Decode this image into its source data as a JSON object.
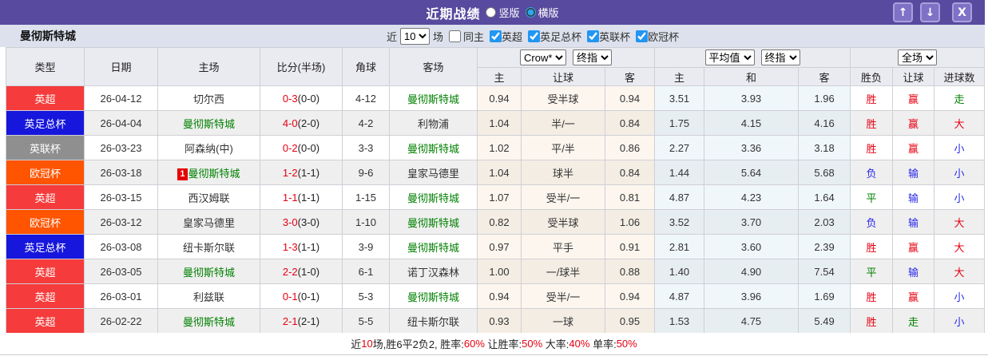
{
  "titlebar": {
    "title": "近期战绩",
    "radio_vertical": "竖版",
    "radio_horizontal": "横版",
    "buttons": {
      "up": "↑",
      "down": "↓",
      "close": "X"
    }
  },
  "controls": {
    "team": "曼彻斯特城",
    "near_label": "近",
    "count_value": "10",
    "games_label": "场",
    "same_home_label": "同主",
    "leagues": [
      "英超",
      "英足总杯",
      "英联杯",
      "欧冠杯"
    ]
  },
  "selectors": {
    "bookmaker": "Crow*",
    "handicap_time": "终指",
    "europe_source": "平均值",
    "europe_time": "终指",
    "scope": "全场"
  },
  "table": {
    "headers": {
      "type": "类型",
      "date": "日期",
      "home": "主场",
      "score": "比分(半场)",
      "corner": "角球",
      "away": "客场",
      "sub": [
        "主",
        "让球",
        "客",
        "主",
        "和",
        "客",
        "胜负",
        "让球",
        "进球数"
      ]
    },
    "rows": [
      {
        "league": "英超",
        "lc": "red",
        "date": "26-04-12",
        "home": "切尔西",
        "home_green": false,
        "marker": "",
        "score": "0-3",
        "half": "(0-0)",
        "corner": "4-12",
        "away": "曼彻斯特城",
        "away_green": true,
        "ah": [
          "0.94",
          "受半球",
          "0.94"
        ],
        "eu": [
          "3.51",
          "3.93",
          "1.96"
        ],
        "res": [
          "胜",
          "red"
        ],
        "ahres": [
          "赢",
          "red"
        ],
        "goal": [
          "走",
          "green"
        ]
      },
      {
        "league": "英足总杯",
        "lc": "blue",
        "date": "26-04-04",
        "home": "曼彻斯特城",
        "home_green": true,
        "marker": "",
        "score": "4-0",
        "half": "(2-0)",
        "corner": "4-2",
        "away": "利物浦",
        "away_green": false,
        "ah": [
          "1.04",
          "半/一",
          "0.84"
        ],
        "eu": [
          "1.75",
          "4.15",
          "4.16"
        ],
        "res": [
          "胜",
          "red"
        ],
        "ahres": [
          "赢",
          "red"
        ],
        "goal": [
          "大",
          "red"
        ]
      },
      {
        "league": "英联杯",
        "lc": "gray",
        "date": "26-03-23",
        "home": "阿森纳(中)",
        "home_green": false,
        "marker": "",
        "score": "0-2",
        "half": "(0-0)",
        "corner": "3-3",
        "away": "曼彻斯特城",
        "away_green": true,
        "ah": [
          "1.02",
          "平/半",
          "0.86"
        ],
        "eu": [
          "2.27",
          "3.36",
          "3.18"
        ],
        "res": [
          "胜",
          "red"
        ],
        "ahres": [
          "赢",
          "red"
        ],
        "goal": [
          "小",
          "blue"
        ]
      },
      {
        "league": "欧冠杯",
        "lc": "orange",
        "date": "26-03-18",
        "home": "曼彻斯特城",
        "home_green": true,
        "marker": "1",
        "score": "1-2",
        "half": "(1-1)",
        "corner": "9-6",
        "away": "皇家马德里",
        "away_green": false,
        "ah": [
          "1.04",
          "球半",
          "0.84"
        ],
        "eu": [
          "1.44",
          "5.64",
          "5.68"
        ],
        "res": [
          "负",
          "blue"
        ],
        "ahres": [
          "输",
          "blue"
        ],
        "goal": [
          "小",
          "blue"
        ]
      },
      {
        "league": "英超",
        "lc": "red",
        "date": "26-03-15",
        "home": "西汉姆联",
        "home_green": false,
        "marker": "",
        "score": "1-1",
        "half": "(1-1)",
        "corner": "1-15",
        "away": "曼彻斯特城",
        "away_green": true,
        "ah": [
          "1.07",
          "受半/一",
          "0.81"
        ],
        "eu": [
          "4.87",
          "4.23",
          "1.64"
        ],
        "res": [
          "平",
          "green"
        ],
        "ahres": [
          "输",
          "blue"
        ],
        "goal": [
          "小",
          "blue"
        ]
      },
      {
        "league": "欧冠杯",
        "lc": "orange",
        "date": "26-03-12",
        "home": "皇家马德里",
        "home_green": false,
        "marker": "",
        "score": "3-0",
        "half": "(3-0)",
        "corner": "1-10",
        "away": "曼彻斯特城",
        "away_green": true,
        "ah": [
          "0.82",
          "受半球",
          "1.06"
        ],
        "eu": [
          "3.52",
          "3.70",
          "2.03"
        ],
        "res": [
          "负",
          "blue"
        ],
        "ahres": [
          "输",
          "blue"
        ],
        "goal": [
          "大",
          "red"
        ]
      },
      {
        "league": "英足总杯",
        "lc": "blue",
        "date": "26-03-08",
        "home": "纽卡斯尔联",
        "home_green": false,
        "marker": "",
        "score": "1-3",
        "half": "(1-1)",
        "corner": "3-9",
        "away": "曼彻斯特城",
        "away_green": true,
        "ah": [
          "0.97",
          "平手",
          "0.91"
        ],
        "eu": [
          "2.81",
          "3.60",
          "2.39"
        ],
        "res": [
          "胜",
          "red"
        ],
        "ahres": [
          "赢",
          "red"
        ],
        "goal": [
          "大",
          "red"
        ]
      },
      {
        "league": "英超",
        "lc": "red",
        "date": "26-03-05",
        "home": "曼彻斯特城",
        "home_green": true,
        "marker": "",
        "score": "2-2",
        "half": "(1-0)",
        "corner": "6-1",
        "away": "诺丁汉森林",
        "away_green": false,
        "ah": [
          "1.00",
          "一/球半",
          "0.88"
        ],
        "eu": [
          "1.40",
          "4.90",
          "7.54"
        ],
        "res": [
          "平",
          "green"
        ],
        "ahres": [
          "输",
          "blue"
        ],
        "goal": [
          "大",
          "red"
        ]
      },
      {
        "league": "英超",
        "lc": "red",
        "date": "26-03-01",
        "home": "利兹联",
        "home_green": false,
        "marker": "",
        "score": "0-1",
        "half": "(0-1)",
        "corner": "5-3",
        "away": "曼彻斯特城",
        "away_green": true,
        "ah": [
          "0.94",
          "受半/一",
          "0.94"
        ],
        "eu": [
          "4.87",
          "3.96",
          "1.69"
        ],
        "res": [
          "胜",
          "red"
        ],
        "ahres": [
          "赢",
          "red"
        ],
        "goal": [
          "小",
          "blue"
        ]
      },
      {
        "league": "英超",
        "lc": "red",
        "date": "26-02-22",
        "home": "曼彻斯特城",
        "home_green": true,
        "marker": "",
        "score": "2-1",
        "half": "(2-1)",
        "corner": "5-5",
        "away": "纽卡斯尔联",
        "away_green": false,
        "ah": [
          "0.93",
          "一球",
          "0.95"
        ],
        "eu": [
          "1.53",
          "4.75",
          "5.49"
        ],
        "res": [
          "胜",
          "red"
        ],
        "ahres": [
          "走",
          "green"
        ],
        "goal": [
          "小",
          "blue"
        ]
      }
    ]
  },
  "footer": {
    "segments": [
      {
        "t": "近",
        "c": "k"
      },
      {
        "t": "10",
        "c": "r"
      },
      {
        "t": "场,胜6平2负2, 胜率:",
        "c": "k"
      },
      {
        "t": "60%",
        "c": "r"
      },
      {
        "t": " 让胜率:",
        "c": "k"
      },
      {
        "t": "50%",
        "c": "r"
      },
      {
        "t": " 大率:",
        "c": "k"
      },
      {
        "t": "40%",
        "c": "r"
      },
      {
        "t": " 单率:",
        "c": "k"
      },
      {
        "t": "50%",
        "c": "r"
      }
    ]
  },
  "colors": {
    "topbar_bg": "#584A9E",
    "button_bg": "#7F71C6",
    "subbar_bg": "#DCE1ED",
    "header_bg": "#EAEAF1",
    "zebra_bg": "#EFEFEF",
    "ah_col_bg": "#FCF6EE",
    "eu_col_bg": "#F0F7FB",
    "red_text": "#E60012",
    "blue_text": "#2828E8",
    "green_text": "#008000",
    "league": {
      "red": "#F53B3B",
      "blue": "#1616DC",
      "gray": "#8F8F8F",
      "orange": "#FF5400"
    }
  }
}
